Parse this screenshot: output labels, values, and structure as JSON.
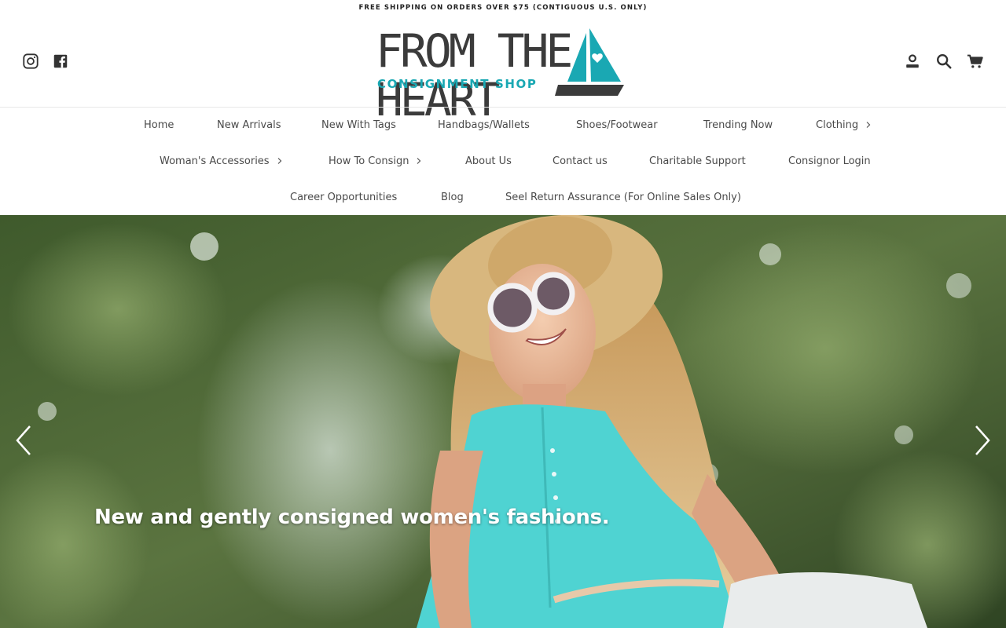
{
  "announcement": "FREE SHIPPING ON ORDERS OVER $75 (CONTIGUOUS U.S. ONLY)",
  "logo": {
    "title": "FROM THE HEART",
    "subtitle": "CONSIGNMENT SHOP"
  },
  "social": [
    "instagram-icon",
    "facebook-icon"
  ],
  "utilities": [
    "account-icon",
    "search-icon",
    "cart-icon"
  ],
  "nav": {
    "row1": [
      "Home",
      "New Arrivals",
      "New With Tags",
      "Handbags/Wallets",
      "Shoes/Footwear",
      "Trending Now",
      "Clothing"
    ],
    "row2": [
      "Woman's Accessories",
      "How To Consign",
      "About Us",
      "Contact us",
      "Charitable Support",
      "Consignor Login"
    ],
    "row3": [
      "Career Opportunities",
      "Blog",
      "Seel Return Assurance (For Online Sales Only)"
    ]
  },
  "hero": {
    "caption": "New and gently consigned women's fashions."
  },
  "colors": {
    "brand_teal": "#1aa8b3",
    "logo_gray": "#3b3b3b",
    "nav_text": "#4a4a4a"
  }
}
